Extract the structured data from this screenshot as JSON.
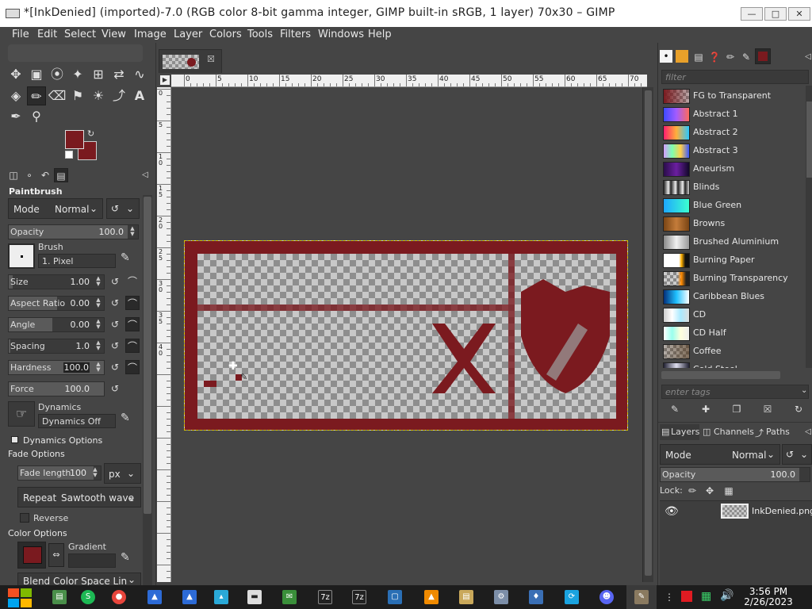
{
  "window": {
    "title": "*[InkDenied] (imported)-7.0 (RGB color 8-bit gamma integer, GIMP built-in sRGB, 1 layer) 70x30 – GIMP",
    "controls": [
      "minimize-icon",
      "maximize-icon",
      "close-icon"
    ]
  },
  "menubar": [
    "File",
    "Edit",
    "Select",
    "View",
    "Image",
    "Layer",
    "Colors",
    "Tools",
    "Filters",
    "Windows",
    "Help"
  ],
  "colors": {
    "foreground": "#7a1a1f",
    "background": "#7a1a1f",
    "accent_image": "#7b1a1f",
    "ui_dark": "#454545"
  },
  "tool_options": {
    "tool_name": "Paintbrush",
    "mode_label": "Mode",
    "mode_value": "Normal",
    "opacity_label": "Opacity",
    "opacity_value": "100.0",
    "brush_label": "Brush",
    "brush_value": "1. Pixel",
    "size_label": "Size",
    "size_value": "1.00",
    "aspect_label": "Aspect Ratio",
    "aspect_value": "0.00",
    "angle_label": "Angle",
    "angle_value": "0.00",
    "spacing_label": "Spacing",
    "spacing_value": "1.0",
    "hardness_label": "Hardness",
    "hardness_value": "100.0",
    "force_label": "Force",
    "force_value": "100.0",
    "dynamics_label": "Dynamics",
    "dynamics_value": "Dynamics Off",
    "dynamics_options": "Dynamics Options",
    "fade_options": "Fade Options",
    "fade_length_label": "Fade length",
    "fade_length_value": "100",
    "fade_unit": "px",
    "repeat_label": "Repeat",
    "repeat_value": "Sawtooth wave",
    "reverse_label": "Reverse",
    "color_options": "Color Options",
    "gradient_label": "Gradient",
    "blend_label": "Blend Color Space Lin"
  },
  "ruler_h_labels": [
    "0",
    "5",
    "10",
    "15",
    "20",
    "25",
    "30",
    "35",
    "40",
    "45",
    "50",
    "55",
    "60",
    "65",
    "70"
  ],
  "ruler_v_labels": [
    "0",
    "5",
    "10",
    "15",
    "20",
    "25",
    "30",
    "35",
    "40"
  ],
  "gradients_panel": {
    "filter_placeholder": "filter",
    "tags_placeholder": "enter tags",
    "items": [
      {
        "name": "FG to Transparent",
        "css": "linear-gradient(90deg,#7a1a1f,rgba(122,26,31,0.2))"
      },
      {
        "name": "Abstract 1",
        "css": "linear-gradient(90deg,#3d4aff,#a25cff,#ff6a5a)"
      },
      {
        "name": "Abstract 2",
        "css": "linear-gradient(90deg,#ff1e6e,#ffb03a,#29c7ff)"
      },
      {
        "name": "Abstract 3",
        "css": "linear-gradient(90deg,#d39bff,#7dffb0,#ffcf4a,#3a59ff)"
      },
      {
        "name": "Aneurism",
        "css": "linear-gradient(90deg,#2a0d4a,#6b1fa0,#12082a)"
      },
      {
        "name": "Blinds",
        "css": "repeating-linear-gradient(90deg,#222 0px,#eee 6px,#222 9px)"
      },
      {
        "name": "Blue Green",
        "css": "linear-gradient(90deg,#1ea7ff,#3cffcf)"
      },
      {
        "name": "Browns",
        "css": "linear-gradient(90deg,#7a4514,#c47c3a,#7a4514)"
      },
      {
        "name": "Brushed Aluminium",
        "css": "linear-gradient(90deg,#888,#f0f0f0,#999)"
      },
      {
        "name": "Burning Paper",
        "css": "linear-gradient(90deg,#fff 60%,#ffb000 70%,#111 85%)"
      },
      {
        "name": "Burning Transparency",
        "css": "linear-gradient(90deg,rgba(0,0,0,0) 55%,#ff8a00 70%,#222 88%)"
      },
      {
        "name": "Caribbean Blues",
        "css": "linear-gradient(90deg,#032e7a,#1fc0ff,#fff)"
      },
      {
        "name": "CD",
        "css": "linear-gradient(90deg,#ccc,#fff,#a9e9ff,#ddd)"
      },
      {
        "name": "CD Half",
        "css": "linear-gradient(90deg,#fff,#9fe,#ffd,#eee)"
      },
      {
        "name": "Coffee",
        "css": "linear-gradient(90deg,rgba(80,50,20,0.2),rgba(80,50,20,0.6))"
      },
      {
        "name": "Cold Steel",
        "css": "linear-gradient(90deg,#223,#dde,#223)"
      }
    ]
  },
  "layers_panel": {
    "tabs": [
      "Layers",
      "Channels",
      "Paths"
    ],
    "mode_label": "Mode",
    "mode_value": "Normal",
    "opacity_label": "Opacity",
    "opacity_value": "100.0",
    "lock_label": "Lock:",
    "layer_name": "InkDenied.png"
  },
  "taskbar": {
    "time": "3:56 PM",
    "date": "2/26/2023"
  }
}
